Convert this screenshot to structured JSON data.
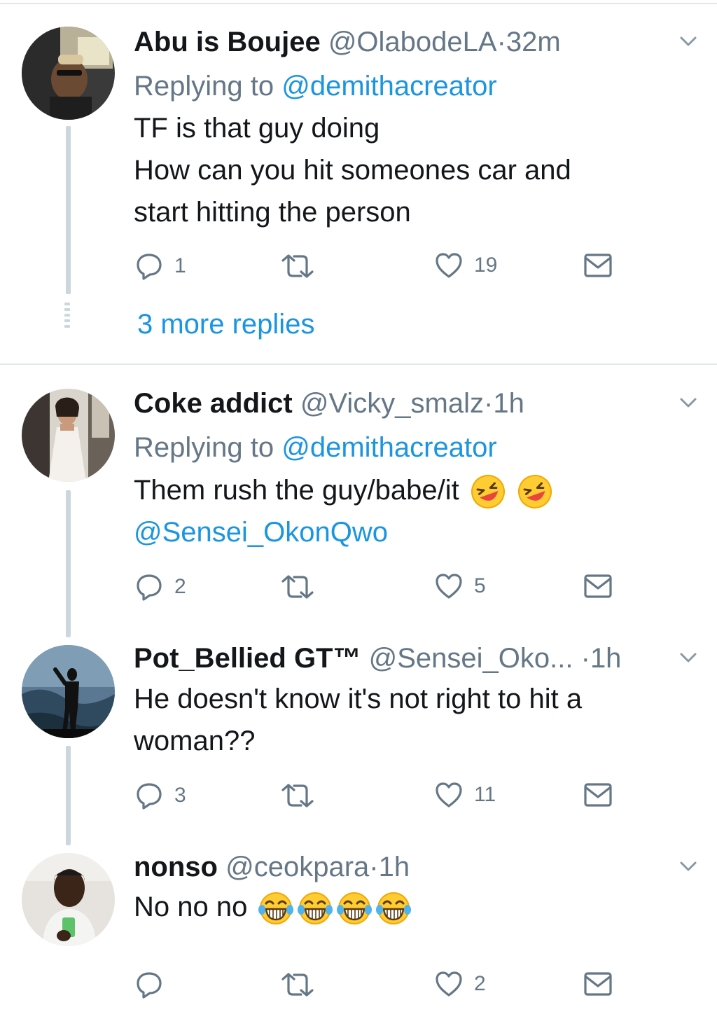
{
  "tweets": [
    {
      "name": "Abu is Boujee",
      "handle": "@OlabodeLA",
      "separator": "·",
      "time": "32m",
      "replying_prefix": "Replying to ",
      "replying_to": "@demithacreator",
      "lines": [
        "TF is that guy doing",
        "How can you hit someones car and",
        "start hitting the person"
      ],
      "replies": "1",
      "retweets": "",
      "likes": "19",
      "more_replies": "3 more replies"
    },
    {
      "name": "Coke addict",
      "handle": "@Vicky_smalz",
      "separator": "·",
      "time": "1h",
      "replying_prefix": "Replying to ",
      "replying_to": "@demithacreator",
      "line1": "Them rush the guy/babe/it",
      "line2_mention": "@Sensei_OkonQwo",
      "replies": "2",
      "retweets": "",
      "likes": "5"
    },
    {
      "name": "Pot_Bellied GT™",
      "handle": "@Sensei_Oko...",
      "separator": "·",
      "time": "1h",
      "lines": [
        "He doesn't know it's not right to hit a",
        "woman??"
      ],
      "replies": "3",
      "retweets": "",
      "likes": "11"
    },
    {
      "name": "nonso",
      "handle": "@ceokpara",
      "separator": "·",
      "time": "1h",
      "line1": "No no no",
      "replies": "",
      "retweets": "",
      "likes": "2"
    }
  ],
  "icons": {
    "reply": "reply-icon",
    "retweet": "retweet-icon",
    "like": "heart-icon",
    "dm": "envelope-icon",
    "more": "chevron-down-icon"
  },
  "colors": {
    "link": "#1b95e0",
    "muted": "#657786",
    "text": "#14171a",
    "divider": "#e1e8ed",
    "thread_line": "#ccd6dd",
    "emoji": "#ffcc33"
  }
}
